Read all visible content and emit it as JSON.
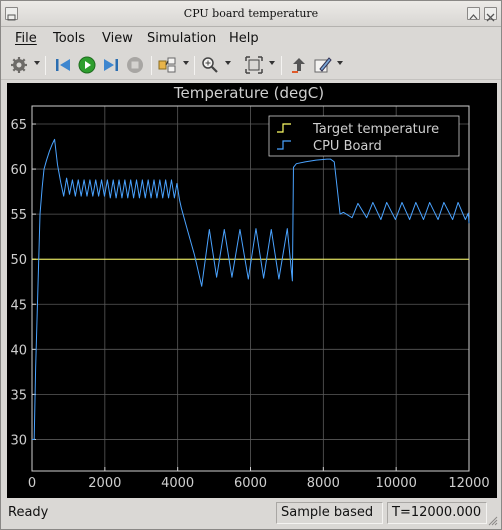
{
  "window": {
    "title": "CPU board temperature"
  },
  "menu": [
    {
      "label": "File",
      "mnemonic": "F"
    },
    {
      "label": "Tools",
      "mnemonic": "T"
    },
    {
      "label": "View",
      "mnemonic": "V"
    },
    {
      "label": "Simulation",
      "mnemonic": "S"
    },
    {
      "label": "Help",
      "mnemonic": "H"
    }
  ],
  "toolbar": {
    "icons": [
      "gear-icon",
      "step-back-icon",
      "run-icon",
      "step-forward-icon",
      "stop-icon",
      "signal-select-icon",
      "zoom-icon",
      "fit-view-icon",
      "highlight-icon",
      "edit-style-icon"
    ]
  },
  "status": {
    "ready": "Ready",
    "mode": "Sample based",
    "time": "T=12000.000"
  },
  "colors": {
    "plot_bg": "#000000",
    "axes": "#cfcfcf",
    "grid": "#5a5a5a",
    "target": "#ffff66",
    "cpu": "#4aa3ff"
  },
  "chart_data": {
    "type": "line",
    "title": "Temperature (degC)",
    "xlim": [
      0,
      12000
    ],
    "ylim": [
      26.5,
      67
    ],
    "xticks": [
      0,
      2000,
      4000,
      6000,
      8000,
      10000,
      12000
    ],
    "yticks": [
      30,
      35,
      40,
      45,
      50,
      55,
      60,
      65
    ],
    "grid": true,
    "legend_position": "top-right",
    "series": [
      {
        "name": "Target  temperature",
        "color": "#ffff66",
        "x": [
          0,
          12000
        ],
        "y": [
          50,
          50
        ]
      },
      {
        "name": "CPU Board",
        "color": "#4aa3ff",
        "x": [
          0,
          60,
          100,
          150,
          220,
          280,
          330,
          400,
          480,
          560,
          620,
          700,
          790,
          870,
          950,
          1030,
          1110,
          1190,
          1270,
          1350,
          1430,
          1510,
          1590,
          1670,
          1750,
          1830,
          1910,
          1990,
          2070,
          2150,
          2230,
          2310,
          2390,
          2470,
          2550,
          2630,
          2710,
          2790,
          2870,
          2950,
          3030,
          3110,
          3190,
          3270,
          3350,
          3430,
          3510,
          3590,
          3670,
          3750,
          3830,
          3910,
          3980,
          4050,
          4100,
          4250,
          4460,
          4660,
          4870,
          5070,
          5280,
          5490,
          5710,
          5940,
          6150,
          6360,
          6570,
          6780,
          7010,
          7150,
          7180,
          7260,
          7500,
          7800,
          8100,
          8200,
          8300,
          8460,
          8550,
          8790,
          8950,
          9190,
          9360,
          9580,
          9740,
          9980,
          10160,
          10370,
          10540,
          10750,
          10920,
          11150,
          11310,
          11550,
          11700,
          11900,
          11980,
          12000
        ],
        "y": [
          30,
          30,
          38,
          45,
          55,
          58,
          60,
          61,
          62,
          62.8,
          63.3,
          60.5,
          58.5,
          57,
          59,
          57.2,
          58.8,
          57,
          58.8,
          57,
          58.8,
          57,
          58.8,
          57,
          58.8,
          57,
          58.8,
          57,
          58.8,
          56.8,
          58.8,
          56.8,
          58.8,
          56.8,
          58.8,
          56.8,
          58.8,
          56.8,
          58.8,
          56.8,
          58.8,
          56.8,
          58.8,
          56.8,
          58.8,
          56.8,
          58.8,
          56.8,
          58.8,
          56.8,
          58.8,
          56.8,
          58.4,
          56.6,
          55.7,
          53.5,
          50.5,
          47,
          53.3,
          48,
          53.3,
          48,
          53.3,
          47.8,
          53.4,
          47.9,
          53.3,
          47.8,
          53.4,
          47.6,
          60.2,
          60.6,
          60.8,
          61,
          61.1,
          61.1,
          60.8,
          55,
          55.2,
          54.6,
          56.2,
          54.6,
          56.3,
          54.4,
          56.3,
          54.4,
          56.3,
          54.4,
          56.3,
          54.4,
          56.3,
          54.4,
          56.3,
          54.4,
          56.3,
          54.4,
          55.1,
          54
        ]
      }
    ]
  }
}
